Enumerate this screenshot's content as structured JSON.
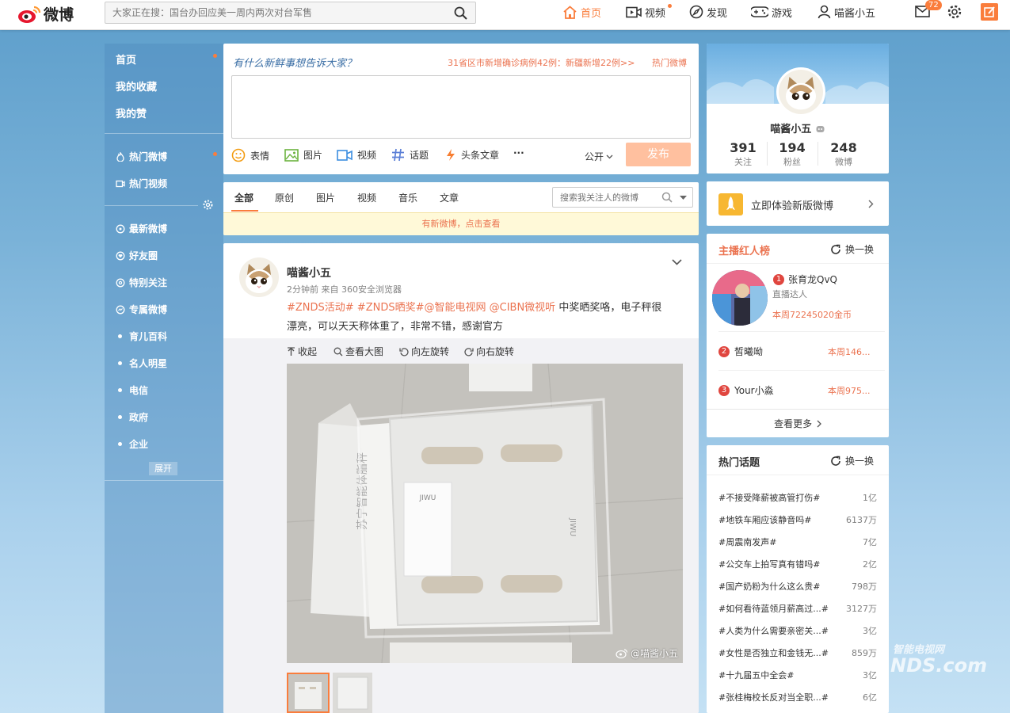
{
  "app": {
    "logo_text": "微博"
  },
  "search": {
    "placeholder": "大家正在搜：国台办回应美一周内两次对台军售"
  },
  "nav": {
    "home": "首页",
    "video": "视频",
    "discover": "发现",
    "games": "游戏",
    "user": "喵酱小五",
    "mail_count": "72"
  },
  "sidebar": {
    "items": [
      "首页",
      "我的收藏",
      "我的赞"
    ],
    "items2": [
      "热门微博",
      "热门视频"
    ],
    "items3": [
      "最新微博",
      "好友圈",
      "特别关注",
      "专属微博"
    ],
    "groups": [
      "育儿百科",
      "名人明星",
      "电信",
      "政府",
      "企业"
    ],
    "expand": "展开"
  },
  "composer": {
    "title": "有什么新鲜事想告诉大家？",
    "hot_news": "31省区市新增确诊病例42例：新疆新增22例>>",
    "hot_link": "热门微博",
    "tools": [
      "表情",
      "图片",
      "视频",
      "话题",
      "头条文章"
    ],
    "more": "···",
    "visibility": "公开",
    "submit": "发布"
  },
  "feed_tabs": {
    "tabs": [
      "全部",
      "原创",
      "图片",
      "视频",
      "音乐",
      "文章"
    ],
    "search_placeholder": "搜索我关注人的微博",
    "new_notice": "有新微博，点击查看"
  },
  "post": {
    "author": "喵酱小五",
    "meta": "2分钟前 来自 360安全浏览器",
    "tags": "#ZNDS活动# #ZNDS晒奖#@智能电视网 @CIBN微视听",
    "text1": " 中奖晒奖咯，电子秤很",
    "text2": "漂亮，可以天天称体重了，非常不错，感谢官方",
    "actions": [
      "收起",
      "查看大图",
      "向左旋转",
      "向右旋转"
    ],
    "watermark": "@喵酱小五"
  },
  "profile": {
    "name": "喵酱小五",
    "stats": [
      {
        "num": "391",
        "label": "关注"
      },
      {
        "num": "194",
        "label": "粉丝"
      },
      {
        "num": "248",
        "label": "微博"
      }
    ]
  },
  "new_version": {
    "text": "立即体验新版微博"
  },
  "anchor_rank": {
    "title": "主播红人榜",
    "refresh": "换一换",
    "first": {
      "rank": "1",
      "name": "张育龙QvQ",
      "role": "直播达人",
      "score": "本周72245020金币"
    },
    "others": [
      {
        "rank": "2",
        "name": "皙曦呦",
        "score": "本周146..."
      },
      {
        "rank": "3",
        "name": "Your小淼",
        "score": "本周975..."
      }
    ],
    "more": "查看更多"
  },
  "hot_topics": {
    "title": "热门话题",
    "refresh": "换一换",
    "items": [
      {
        "name": "#不接受降薪被高管打伤#",
        "count": "1亿"
      },
      {
        "name": "#地铁车厢应该静音吗#",
        "count": "6137万"
      },
      {
        "name": "#周震南发声#",
        "count": "7亿"
      },
      {
        "name": "#公交车上拍写真有错吗#",
        "count": "2亿"
      },
      {
        "name": "#国产奶粉为什么这么贵#",
        "count": "798万"
      },
      {
        "name": "#如何看待蓝领月薪高过...#",
        "count": "3127万"
      },
      {
        "name": "#人类为什么需要亲密关...#",
        "count": "3亿"
      },
      {
        "name": "#女性是否独立和金钱无...#",
        "count": "859万"
      },
      {
        "name": "#十九届五中全会#",
        "count": "3亿"
      },
      {
        "name": "#张桂梅校长反对当全职...#",
        "count": "6亿"
      }
    ]
  },
  "site_watermark": {
    "line1": "智能电视网",
    "line2": "NDS.com"
  }
}
